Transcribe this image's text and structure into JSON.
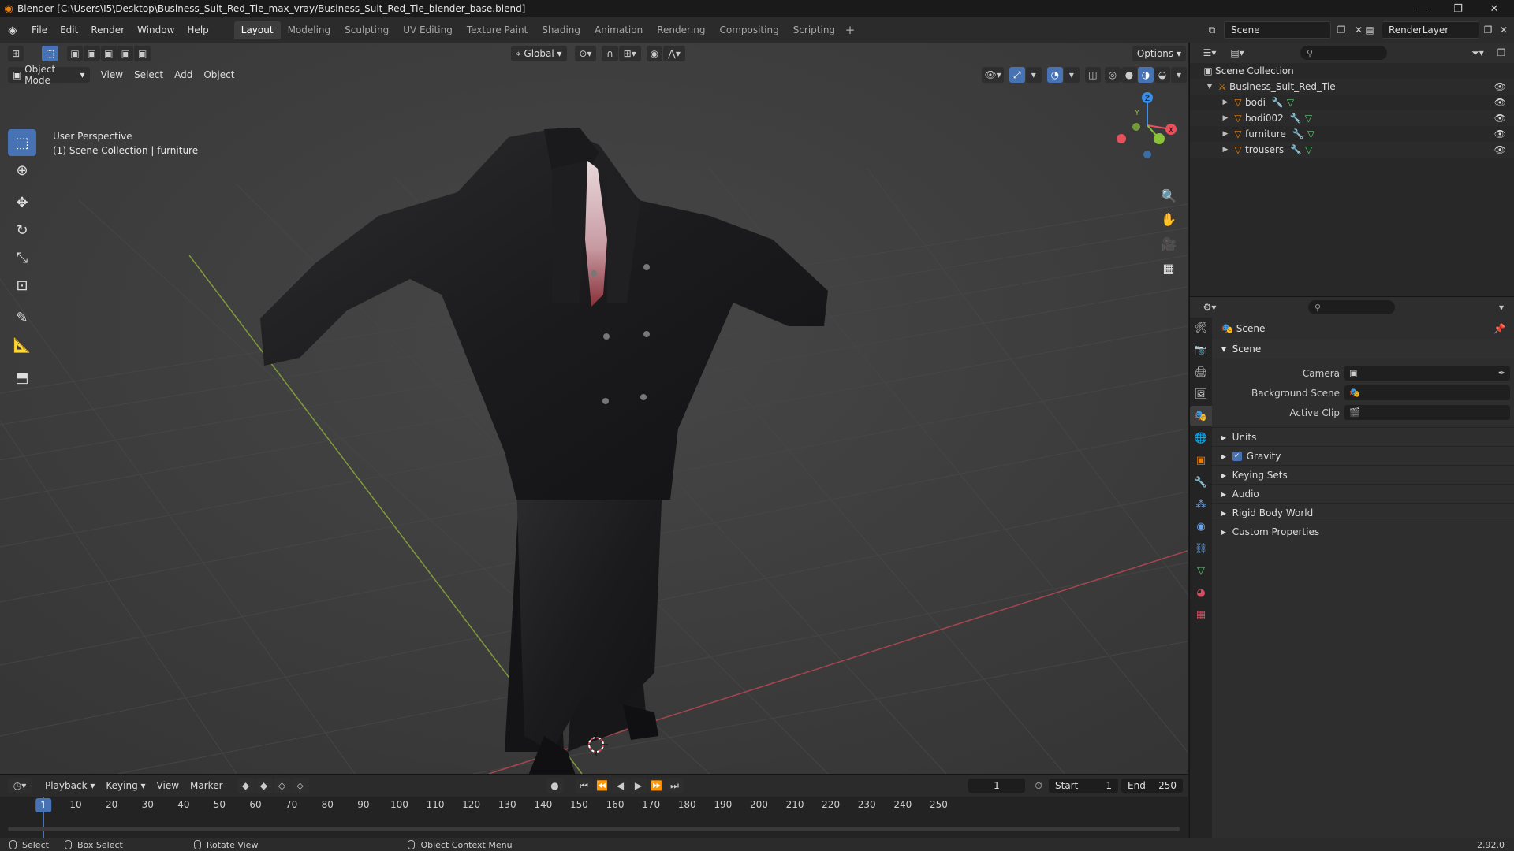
{
  "window": {
    "title": "Blender [C:\\Users\\I5\\Desktop\\Business_Suit_Red_Tie_max_vray/Business_Suit_Red_Tie_blender_base.blend]",
    "minimize": "—",
    "restore": "❐",
    "close": "✕"
  },
  "menus": [
    "File",
    "Edit",
    "Render",
    "Window",
    "Help"
  ],
  "workspaces": [
    "Layout",
    "Modeling",
    "Sculpting",
    "UV Editing",
    "Texture Paint",
    "Shading",
    "Animation",
    "Rendering",
    "Compositing",
    "Scripting"
  ],
  "active_workspace": "Layout",
  "scene_selector": {
    "scene": "Scene",
    "render_layer": "RenderLayer"
  },
  "viewport": {
    "mode": "Object Mode",
    "menu": [
      "View",
      "Select",
      "Add",
      "Object"
    ],
    "transform_orientation": "Global",
    "options_label": "Options",
    "info_line1": "User Perspective",
    "info_line2": "(1) Scene Collection | furniture",
    "gizmo_axes": {
      "x": "X",
      "y": "Y",
      "z": "Z"
    }
  },
  "timeline": {
    "menu": [
      "Playback",
      "Keying",
      "View",
      "Marker"
    ],
    "current_frame": "1",
    "start_label": "Start",
    "start": "1",
    "end_label": "End",
    "end": "250",
    "ruler": [
      "10",
      "20",
      "30",
      "40",
      "50",
      "60",
      "70",
      "80",
      "90",
      "100",
      "110",
      "120",
      "130",
      "140",
      "150",
      "160",
      "170",
      "180",
      "190",
      "200",
      "210",
      "220",
      "230",
      "240",
      "250"
    ]
  },
  "status": {
    "select": "Select",
    "box_select": "Box Select",
    "rotate_view": "Rotate View",
    "context_menu": "Object Context Menu",
    "version": "2.92.0"
  },
  "outliner": {
    "root": "Scene Collection",
    "collection": "Business_Suit_Red_Tie",
    "objects": [
      "bodi",
      "bodi002",
      "furniture",
      "trousers"
    ]
  },
  "properties": {
    "context": "Scene",
    "panel": "Scene",
    "camera_label": "Camera",
    "background_label": "Background Scene",
    "clip_label": "Active Clip",
    "subpanels": [
      "Units",
      "Gravity",
      "Keying Sets",
      "Audio",
      "Rigid Body World",
      "Custom Properties"
    ]
  },
  "colors": {
    "accent": "#4772b3",
    "object": "#e87d0d",
    "x_axis": "#e8505e",
    "y_axis": "#8ac33a",
    "z_axis": "#3d8ee8"
  }
}
